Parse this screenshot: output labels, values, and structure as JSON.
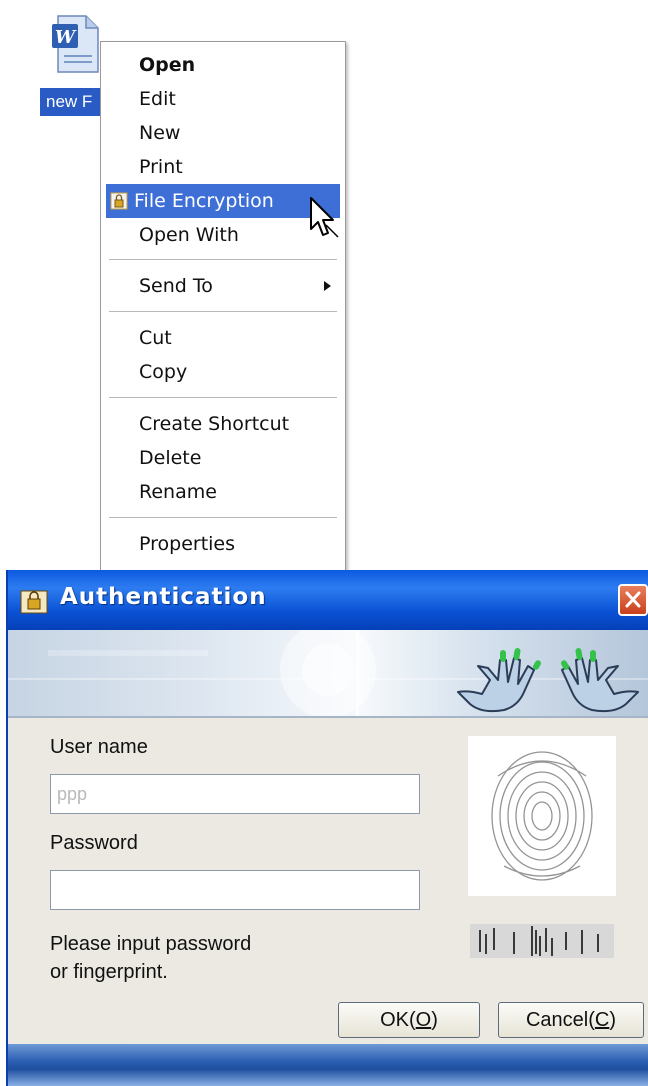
{
  "desktop": {
    "file_label": "new F"
  },
  "context_menu": {
    "items": [
      {
        "label": "Open"
      },
      {
        "label": "Edit"
      },
      {
        "label": "New"
      },
      {
        "label": "Print"
      },
      {
        "label": "File Encryption"
      },
      {
        "label": "Open With"
      },
      {
        "label": "Send To"
      },
      {
        "label": "Cut"
      },
      {
        "label": "Copy"
      },
      {
        "label": "Create Shortcut"
      },
      {
        "label": "Delete"
      },
      {
        "label": "Rename"
      },
      {
        "label": "Properties"
      }
    ],
    "highlight_color": "#3d6fd6"
  },
  "dialog": {
    "title": "Authentication",
    "username_label": "User name",
    "username_placeholder": "ppp",
    "password_label": "Password",
    "password_value": "",
    "hint_line1": "Please input password",
    "hint_line2": "or fingerprint.",
    "ok_label": "OK(",
    "ok_key": "O",
    "cancel_label": "Cancel(",
    "cancel_key": "C",
    "titlebar_color": "#0a51d4",
    "body_color": "#ebe9e2"
  },
  "icons": {
    "file": "word-document-icon",
    "encryption": "lock-file-icon",
    "cursor": "mouse-pointer-icon",
    "close": "close-icon",
    "fingerprint": "fingerprint-image",
    "hands": "hands-logo-icon"
  }
}
